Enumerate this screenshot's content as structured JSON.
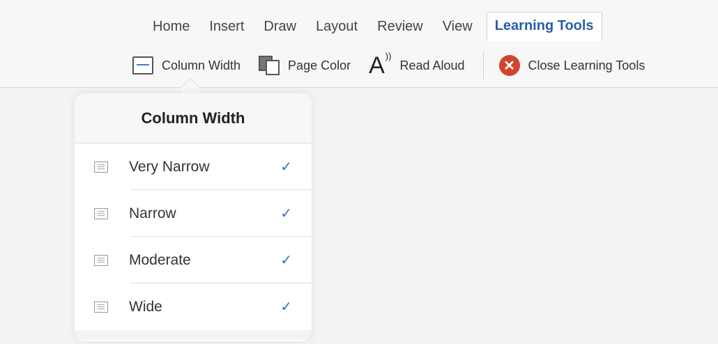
{
  "tabs": [
    {
      "label": "Home",
      "active": false
    },
    {
      "label": "Insert",
      "active": false
    },
    {
      "label": "Draw",
      "active": false
    },
    {
      "label": "Layout",
      "active": false
    },
    {
      "label": "Review",
      "active": false
    },
    {
      "label": "View",
      "active": false
    },
    {
      "label": "Learning Tools",
      "active": true
    }
  ],
  "toolbar": {
    "column_width": {
      "label": "Column Width",
      "icon": "column-width-icon"
    },
    "page_color": {
      "label": "Page Color",
      "icon": "page-color-icon"
    },
    "read_aloud": {
      "label": "Read Aloud",
      "icon": "read-aloud-icon",
      "glyph": "A"
    },
    "close": {
      "label": "Close Learning Tools",
      "icon": "close-icon",
      "glyph": "✕"
    }
  },
  "popover": {
    "title": "Column Width",
    "options": [
      {
        "label": "Very Narrow",
        "checked": true,
        "check": "✓"
      },
      {
        "label": "Narrow",
        "checked": true,
        "check": "✓"
      },
      {
        "label": "Moderate",
        "checked": true,
        "check": "✓"
      },
      {
        "label": "Wide",
        "checked": true,
        "check": "✓"
      }
    ]
  },
  "colors": {
    "accent": "#2b5fa8",
    "check": "#2b6fd6",
    "close_button": "#d1452f"
  }
}
